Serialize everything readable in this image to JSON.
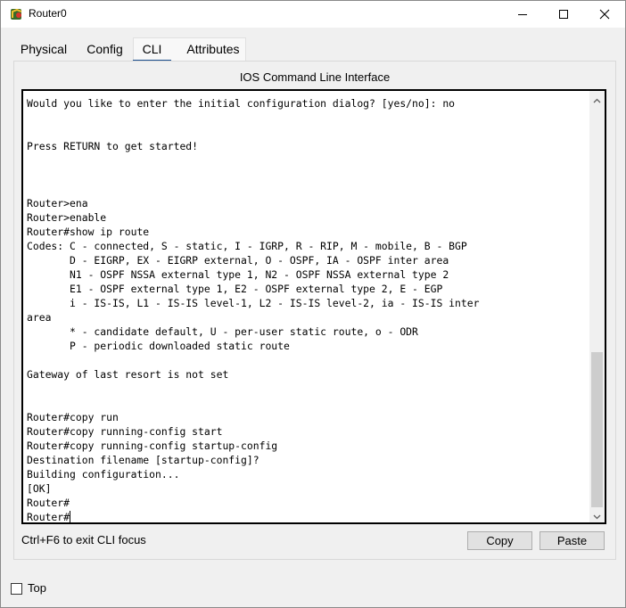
{
  "window": {
    "title": "Router0",
    "controls": {
      "minimize": "minimize-icon",
      "maximize": "maximize-icon",
      "close": "close-icon"
    }
  },
  "tabs": [
    {
      "label": "Physical",
      "active": false
    },
    {
      "label": "Config",
      "active": false
    },
    {
      "label": "CLI",
      "active": true
    },
    {
      "label": "Attributes",
      "active": false
    }
  ],
  "panel": {
    "title": "IOS Command Line Interface"
  },
  "terminal": {
    "lines": [
      "Would you like to enter the initial configuration dialog? [yes/no]: no",
      "",
      "",
      "Press RETURN to get started!",
      "",
      "",
      "",
      "Router>ena",
      "Router>enable",
      "Router#show ip route",
      "Codes: C - connected, S - static, I - IGRP, R - RIP, M - mobile, B - BGP",
      "       D - EIGRP, EX - EIGRP external, O - OSPF, IA - OSPF inter area",
      "       N1 - OSPF NSSA external type 1, N2 - OSPF NSSA external type 2",
      "       E1 - OSPF external type 1, E2 - OSPF external type 2, E - EGP",
      "       i - IS-IS, L1 - IS-IS level-1, L2 - IS-IS level-2, ia - IS-IS inter",
      "area",
      "       * - candidate default, U - per-user static route, o - ODR",
      "       P - periodic downloaded static route",
      "",
      "Gateway of last resort is not set",
      "",
      "",
      "Router#copy run",
      "Router#copy running-config start",
      "Router#copy running-config startup-config",
      "Destination filename [startup-config]?",
      "Building configuration...",
      "[OK]",
      "Router#",
      "Router#"
    ],
    "scroll_position": 0.62
  },
  "footer": {
    "hint": "Ctrl+F6 to exit CLI focus",
    "copy_label": "Copy",
    "paste_label": "Paste"
  },
  "top_option": {
    "label": "Top",
    "checked": false
  },
  "colors": {
    "active_tab_underline": "#1c4f8f",
    "window_bg": "#f0f0f0",
    "terminal_bg": "#ffffff"
  }
}
